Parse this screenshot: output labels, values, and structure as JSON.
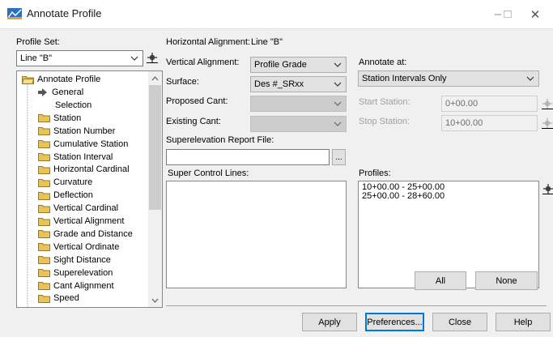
{
  "window": {
    "title": "Annotate Profile",
    "minimize_symbol": "–",
    "maximize_symbol": "□",
    "close_symbol": "✕"
  },
  "left": {
    "profile_set_label": "Profile Set:",
    "profile_set_value": "Line \"B\"",
    "tree": {
      "root": "Annotate Profile",
      "items": [
        "General",
        "Selection",
        "Station",
        "Station Number",
        "Cumulative Station",
        "Station Interval",
        "Horizontal Cardinal",
        "Curvature",
        "Deflection",
        "Vertical Cardinal",
        "Vertical Alignment",
        "Grade and Distance",
        "Vertical Ordinate",
        "Sight Distance",
        "Superelevation",
        "Cant Alignment",
        "Speed"
      ]
    }
  },
  "middle": {
    "horizontal_alignment_label": "Horizontal Alignment:",
    "horizontal_alignment_value": "Line \"B\"",
    "vertical_alignment_label": "Vertical Alignment:",
    "vertical_alignment_value": "Profile Grade",
    "surface_label": "Surface:",
    "surface_value": "Des #_SRxx",
    "proposed_cant_label": "Proposed Cant:",
    "proposed_cant_value": "",
    "existing_cant_label": "Existing Cant:",
    "existing_cant_value": "",
    "superelevation_report_label": "Superelevation Report File:",
    "superelevation_report_value": "",
    "browse_label": "...",
    "super_control_lines_label": "Super Control Lines:"
  },
  "right": {
    "annotate_at_label": "Annotate at:",
    "annotate_at_value": "Station Intervals Only",
    "start_station_label": "Start Station:",
    "start_station_value": "0+00.00",
    "stop_station_label": "Stop Station:",
    "stop_station_value": "10+00.00",
    "profiles_label": "Profiles:",
    "profiles": [
      "10+00.00 - 25+00.00",
      "25+00.00 - 28+60.00"
    ],
    "all_label": "All",
    "none_label": "None"
  },
  "footer": {
    "apply_label": "Apply",
    "preferences_label": "Preferences...",
    "close_label": "Close",
    "help_label": "Help"
  },
  "colors": {
    "focus_border": "#0078d7",
    "dialog_bg": "#f0f0f0",
    "folder_yellow": "#e8c55a"
  }
}
